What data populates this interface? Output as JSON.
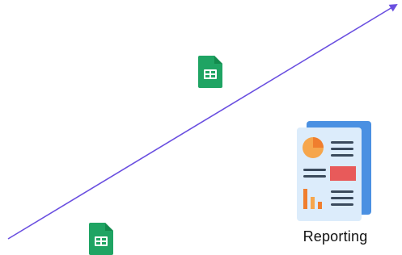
{
  "diagram": {
    "trend_arrow": {
      "icon": "trend-arrow",
      "color": "#6a4fe0"
    },
    "sheet_icons": [
      {
        "icon": "google-sheets-icon",
        "color": "#1fa463"
      },
      {
        "icon": "google-sheets-icon",
        "color": "#1fa463"
      }
    ],
    "report": {
      "icon": "report-document-icon",
      "label": "Reporting",
      "colors": {
        "paper": "#dcecfb",
        "back_page": "#4a90e2",
        "accent": "#f07e2e",
        "accent_light": "#f6a64c",
        "lines": "#3a4a5c",
        "red_block": "#e85a5a"
      }
    }
  }
}
